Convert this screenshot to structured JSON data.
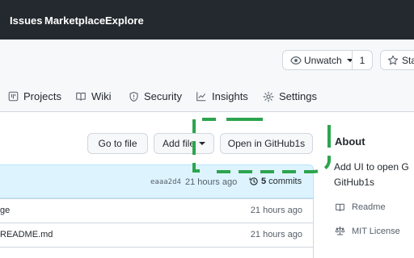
{
  "topnav": {
    "links": [
      "Issues",
      "Marketplace",
      "Explore"
    ]
  },
  "repohead": {
    "unwatch_label": "Unwatch",
    "watch_count": "1",
    "star_label": "Star",
    "tabs": [
      "Projects",
      "Wiki",
      "Security",
      "Insights",
      "Settings"
    ]
  },
  "toolbar": {
    "go_to_file": "Go to file",
    "add_file": "Add file",
    "open_in": "Open in GitHub1s"
  },
  "commit": {
    "sha": "eaaa2d4",
    "ago": "21 hours ago",
    "count": "5",
    "commits_label": "commits"
  },
  "files": [
    {
      "name": "ge",
      "time": "21 hours ago"
    },
    {
      "name": "README.md",
      "time": "21 hours ago"
    }
  ],
  "about": {
    "title": "About",
    "desc_line1": "Add UI to open G",
    "desc_line2": "GitHub1s",
    "readme": "Readme",
    "license": "MIT License"
  },
  "colors": {
    "nav_bg": "#24292f",
    "annotation": "#2da44e",
    "commit_bar": "#ddf4ff"
  }
}
